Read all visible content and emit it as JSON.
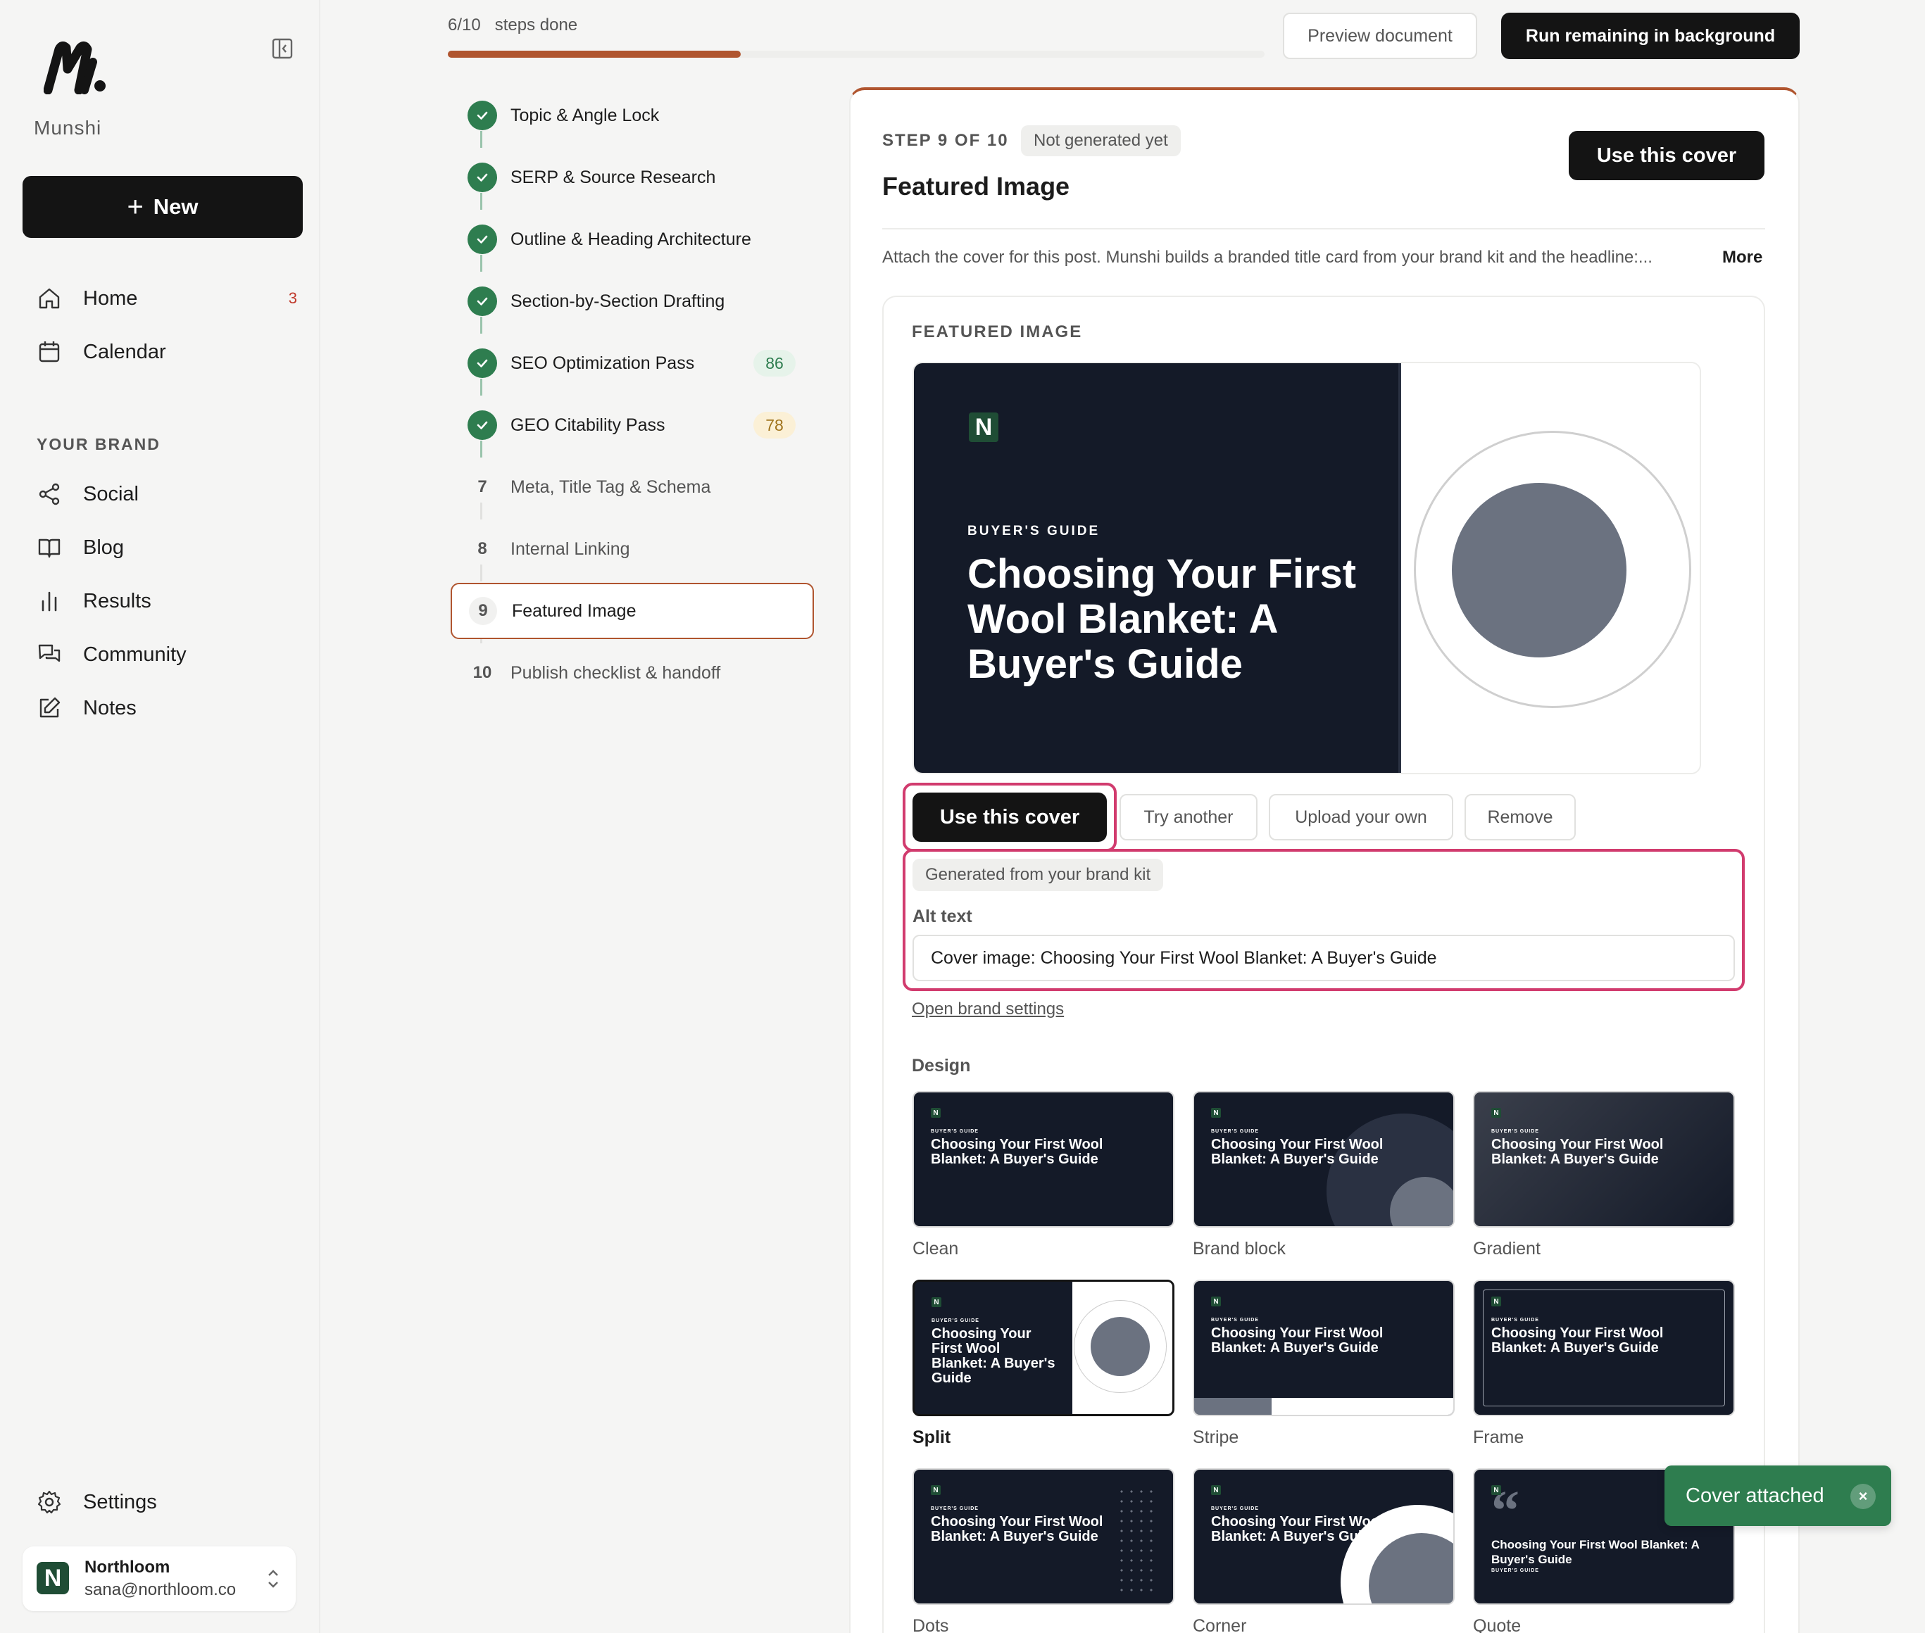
{
  "sidebar": {
    "brand_name": "Munshi",
    "new_label": "New",
    "nav": [
      {
        "label": "Home",
        "icon": "home-icon",
        "badge": "3"
      },
      {
        "label": "Calendar",
        "icon": "calendar-icon"
      }
    ],
    "section_label": "YOUR BRAND",
    "brand_nav": [
      {
        "label": "Social",
        "icon": "share-icon"
      },
      {
        "label": "Blog",
        "icon": "book-icon"
      },
      {
        "label": "Results",
        "icon": "bar-chart-icon"
      },
      {
        "label": "Community",
        "icon": "chat-icon"
      },
      {
        "label": "Notes",
        "icon": "edit-icon"
      }
    ],
    "settings_label": "Settings",
    "account": {
      "logo_letter": "N",
      "name": "Northloom",
      "email": "sana@northloom.co"
    }
  },
  "progress": {
    "count": "6/10",
    "label": "steps done",
    "fraction": 0.6
  },
  "steps": [
    {
      "num": "1",
      "label": "Topic & Angle Lock",
      "state": "done"
    },
    {
      "num": "2",
      "label": "SERP & Source Research",
      "state": "done"
    },
    {
      "num": "3",
      "label": "Outline & Heading Architecture",
      "state": "done"
    },
    {
      "num": "4",
      "label": "Section-by-Section Drafting",
      "state": "done"
    },
    {
      "num": "5",
      "label": "SEO Optimization Pass",
      "state": "done",
      "score": "86"
    },
    {
      "num": "6",
      "label": "GEO Citability Pass",
      "state": "done",
      "score": "78"
    },
    {
      "num": "7",
      "label": "Meta, Title Tag & Schema",
      "state": "todo"
    },
    {
      "num": "8",
      "label": "Internal Linking",
      "state": "todo"
    },
    {
      "num": "9",
      "label": "Featured Image",
      "state": "active"
    },
    {
      "num": "10",
      "label": "Publish checklist & handoff",
      "state": "todo"
    }
  ],
  "toolbar": {
    "preview_label": "Preview document",
    "run_label": "Run remaining in background"
  },
  "card": {
    "step_count": "STEP 9 OF 10",
    "status": "Not generated yet",
    "title": "Featured Image",
    "use_cover_label": "Use this cover",
    "description": "Attach the cover for this post. Munshi builds a branded title card from your brand kit and the headline:...",
    "more_label": "More",
    "section_label": "FEATURED IMAGE",
    "preview": {
      "logo_letter": "N",
      "kicker": "BUYER'S GUIDE",
      "title": "Choosing Your First Wool Blanket: A Buyer's Guide"
    },
    "actions": {
      "use": "Use this cover",
      "try": "Try another",
      "upload": "Upload your own",
      "remove": "Remove"
    },
    "generated_pill": "Generated from your brand kit",
    "alt_label": "Alt text",
    "alt_value": "Cover image: Choosing Your First Wool Blanket: A Buyer's Guide",
    "brand_settings_link": "Open brand settings",
    "design_label": "Design",
    "designs": [
      {
        "name": "Clean",
        "selected": false,
        "title": "Choosing Your First Wool Blanket: A Buyer's Guide",
        "kicker": "BUYER'S GUIDE",
        "logo": "N"
      },
      {
        "name": "Brand block",
        "selected": false,
        "title": "Choosing Your First Wool Blanket: A Buyer's Guide",
        "kicker": "BUYER'S GUIDE",
        "logo": "N"
      },
      {
        "name": "Gradient",
        "selected": false,
        "title": "Choosing Your First Wool Blanket: A Buyer's Guide",
        "kicker": "BUYER'S GUIDE",
        "logo": "N"
      },
      {
        "name": "Split",
        "selected": true,
        "title": "Choosing Your First Wool Blanket: A Buyer's Guide",
        "kicker": "BUYER'S GUIDE",
        "logo": "N"
      },
      {
        "name": "Stripe",
        "selected": false,
        "title": "Choosing Your First Wool Blanket: A Buyer's Guide",
        "kicker": "BUYER'S GUIDE",
        "logo": "N"
      },
      {
        "name": "Frame",
        "selected": false,
        "title": "Choosing Your First Wool Blanket: A Buyer's Guide",
        "kicker": "BUYER'S GUIDE",
        "logo": "N"
      },
      {
        "name": "Dots",
        "selected": false,
        "title": "Choosing Your First Wool Blanket: A Buyer's Guide",
        "kicker": "BUYER'S GUIDE",
        "logo": "N"
      },
      {
        "name": "Corner",
        "selected": false,
        "title": "Choosing Your First Wool Blanket: A Buyer's Guide",
        "kicker": "BUYER'S GUIDE",
        "logo": "N"
      },
      {
        "name": "Quote",
        "selected": false,
        "title": "Choosing Your First Wool Blanket: A Buyer's Guide",
        "kicker": "BUYER'S GUIDE",
        "logo": "N"
      }
    ]
  },
  "toast": {
    "message": "Cover attached"
  },
  "colors": {
    "accent": "#b0552f",
    "success": "#2e7d4f",
    "highlight": "#d13b6e",
    "dark": "#141414",
    "cover_bg": "#141a28"
  }
}
